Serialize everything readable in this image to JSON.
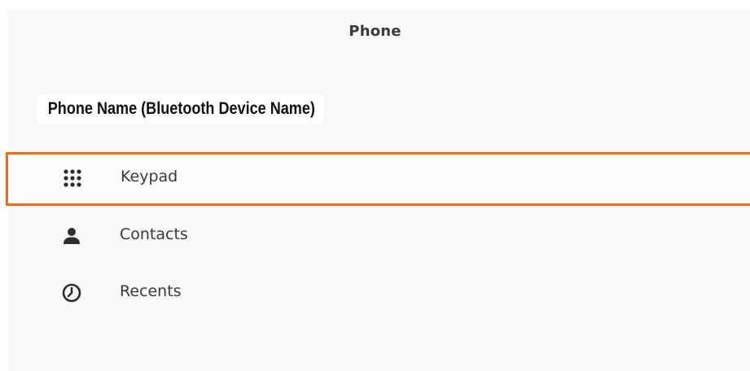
{
  "header": {
    "title": "Phone"
  },
  "device": {
    "name": "Phone Name (Bluetooth Device Name)"
  },
  "menu": {
    "items": [
      {
        "label": "Keypad",
        "icon": "keypad-icon",
        "selected": true
      },
      {
        "label": "Contacts",
        "icon": "contacts-icon",
        "selected": false
      },
      {
        "label": "Recents",
        "icon": "recents-icon",
        "selected": false
      }
    ]
  },
  "colors": {
    "selection_border": "#ee6a1c",
    "background": "#f8f8f7",
    "text": "#3a3a3a"
  }
}
